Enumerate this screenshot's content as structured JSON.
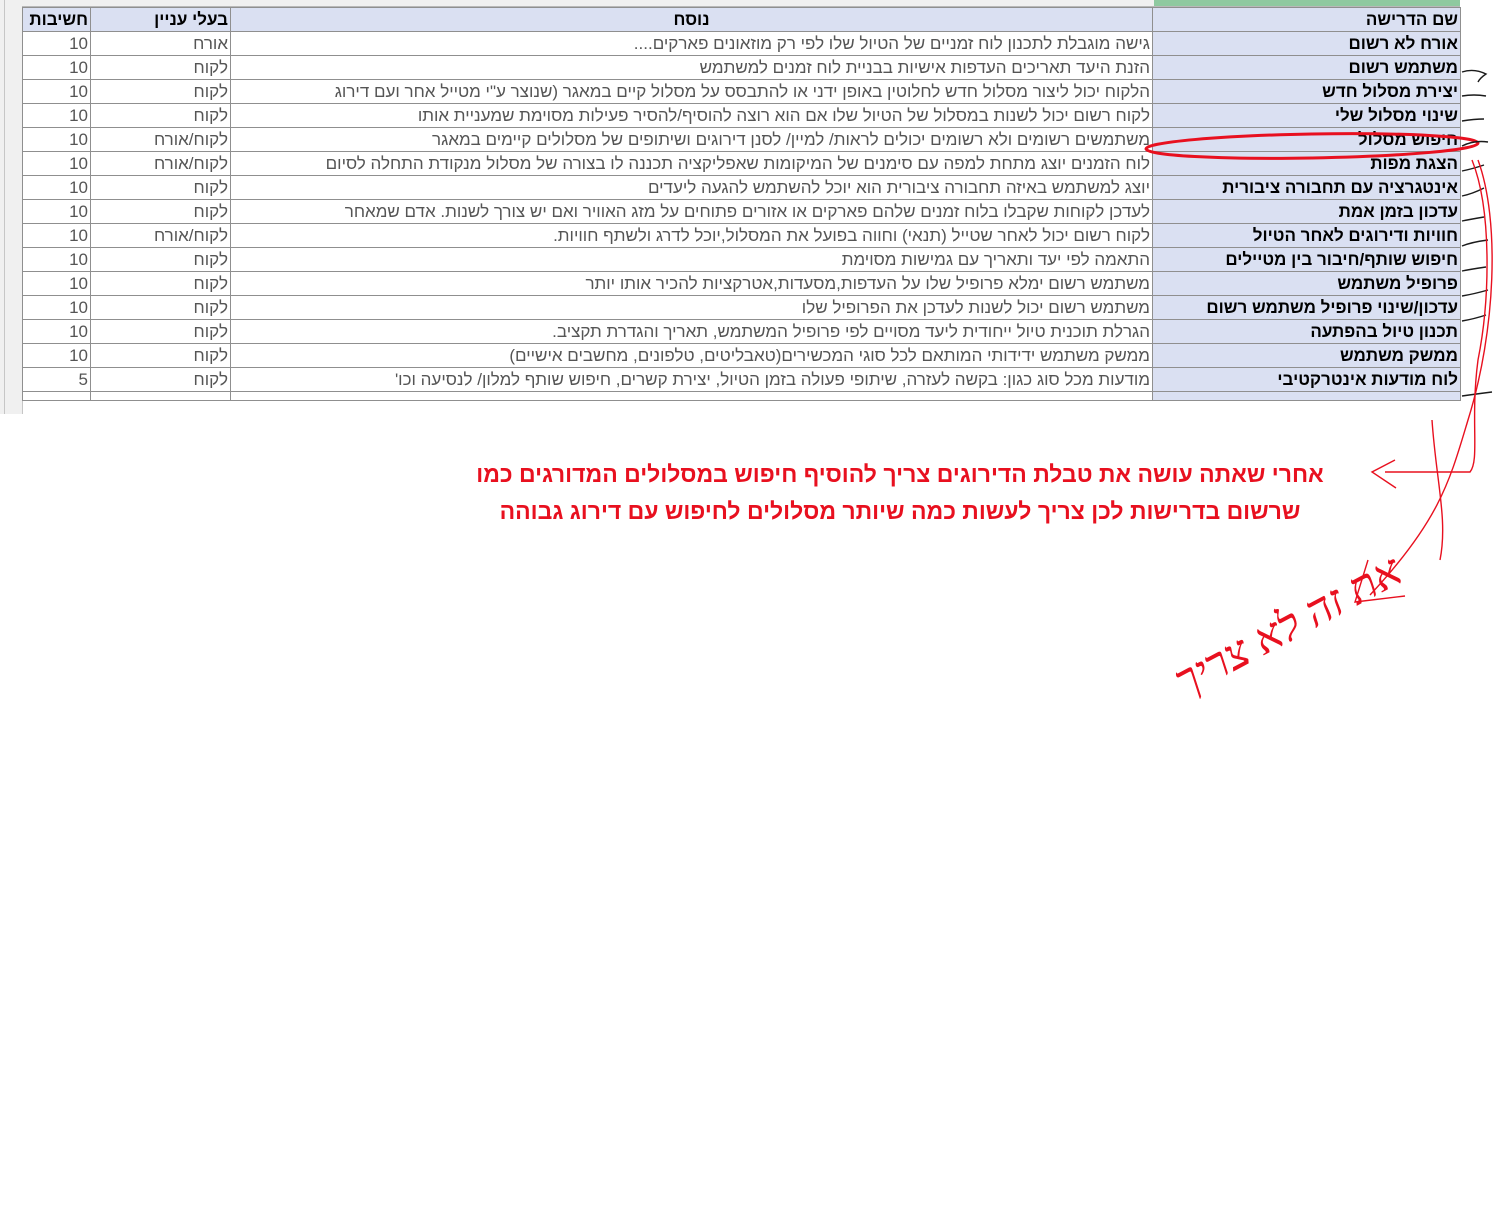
{
  "table": {
    "headers": {
      "name": "שם הדרישה",
      "text": "נוסח",
      "stakeholder": "בעלי עניין",
      "importance": "חשיבות"
    },
    "rows": [
      {
        "name": "אורח לא רשום",
        "text": "גישה מוגבלת לתכנון לוח זמניים של הטיול שלו לפי רק מוזאונים פארקים....",
        "stakeholder": "אורח",
        "importance": "10"
      },
      {
        "name": "משתמש רשום",
        "text": "הזנת היעד תאריכים העדפות אישיות בבניית לוח זמנים למשתמש",
        "stakeholder": "לקוח",
        "importance": "10"
      },
      {
        "name": "יצירת מסלול חדש",
        "text": "הלקוח יכול ליצור מסלול חדש לחלוטין באופן ידני או להתבסס על מסלול קיים במאגר (שנוצר ע\"י מטייל אחר ועם דירוג",
        "stakeholder": "לקוח",
        "importance": "10"
      },
      {
        "name": "שינוי מסלול שלי",
        "text": "לקוח רשום יכול לשנות במסלול של הטיול שלו אם הוא רוצה להוסיף/להסיר פעילות מסוימת שמעניית אותו",
        "stakeholder": "לקוח",
        "importance": "10"
      },
      {
        "name": "חיפוש מסלול",
        "text": "משתמשים רשומים ולא רשומים יכולים לראות/ למיין/ לסנן דירוגים ושיתופים של מסלולים קיימים במאגר",
        "stakeholder": "לקוח/אורח",
        "importance": "10"
      },
      {
        "name": "הצגת מפות",
        "text": "לוח הזמנים יוצג מתחת למפה עם סימנים של המיקומות שאפליקציה תכננה לו בצורה של מסלול מנקודת התחלה לסיום",
        "stakeholder": "לקוח/אורח",
        "importance": "10"
      },
      {
        "name": "אינטגרציה עם תחבורה ציבורית",
        "text": "יוצג למשתמש באיזה תחבורה ציבורית הוא יוכל להשתמש להגעה ליעדים",
        "stakeholder": "לקוח",
        "importance": "10"
      },
      {
        "name": "עדכון בזמן אמת",
        "text": "לעדכן לקוחות שקבלו בלוח זמנים שלהם פארקים או אזורים פתוחים על מזג האוויר ואם יש צורך לשנות. אדם שמאחר",
        "stakeholder": "לקוח",
        "importance": "10"
      },
      {
        "name": "חוויות ודירוגים לאחר הטיול",
        "text": "לקוח רשום יכול  לאחר שטייל (תנאי) וחווה בפועל את המסלול,יוכל לדרג ולשתף חוויות.",
        "stakeholder": "לקוח/אורח",
        "importance": "10"
      },
      {
        "name": "חיפוש שותף/חיבור בין מטיילים",
        "text": "התאמה לפי יעד ותאריך עם גמישות מסוימת",
        "stakeholder": "לקוח",
        "importance": "10"
      },
      {
        "name": "פרופיל משתמש",
        "text": "משתמש רשום ימלא פרופיל שלו על העדפות,מסעדות,אטרקציות להכיר אותו יותר",
        "stakeholder": "לקוח",
        "importance": "10"
      },
      {
        "name": "עדכון/שינוי פרופיל משתמש רשום",
        "text": "משתמש רשום יכול לשנות לעדכן את הפרופיל שלו",
        "stakeholder": "לקוח",
        "importance": "10"
      },
      {
        "name": "תכנון טיול בהפתעה",
        "text": "הגרלת תוכנית טיול ייחודית ליעד מסויים לפי פרופיל המשתמש, תאריך והגדרת תקציב.",
        "stakeholder": "לקוח",
        "importance": "10"
      },
      {
        "name": "ממשק משתמש",
        "text": "ממשק משתמש ידידותי המותאם לכל סוגי המכשירים(טאבליטים, טלפונים, מחשבים אישיים)",
        "stakeholder": "לקוח",
        "importance": "10"
      },
      {
        "name": "לוח מודעות אינטרקטיבי",
        "text": "מודעות מכל סוג כגון: בקשה לעזרה, שיתופי פעולה בזמן הטיול, יצירת קשרים, חיפוש שותף למלון/ לנסיעה וכו'",
        "stakeholder": "לקוח",
        "importance": "5"
      }
    ]
  },
  "annotation": {
    "line1": "אחרי שאתה עושה את טבלת הדירוגים צריך להוסיף חיפוש במסלולים המדורגים כמו",
    "line2": "שרשום בדרישות לכן צריך לעשות כמה שיותר מסלולים לחיפוש עם דירוג גבוהה",
    "handwriting": "את זה לא צריך",
    "color": "#e8101f"
  }
}
